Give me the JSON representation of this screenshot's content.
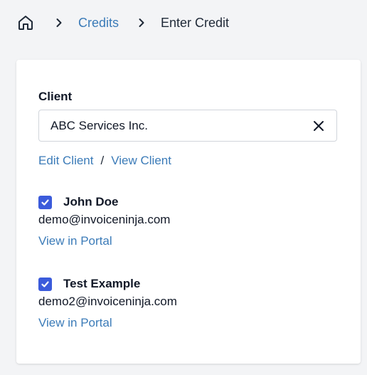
{
  "breadcrumb": {
    "home_icon": "home-icon",
    "items": [
      {
        "label": "Credits"
      },
      {
        "label": "Enter Credit"
      }
    ]
  },
  "client_section": {
    "label": "Client",
    "selected_value": "ABC Services Inc.",
    "clear_icon": "close-icon",
    "edit_link": "Edit Client",
    "separator": "/",
    "view_link": "View Client"
  },
  "contacts": [
    {
      "name": "John Doe",
      "email": "demo@invoiceninja.com",
      "portal_link": "View in Portal",
      "checked": true
    },
    {
      "name": "Test Example",
      "email": "demo2@invoiceninja.com",
      "portal_link": "View in Portal",
      "checked": true
    }
  ],
  "colors": {
    "link": "#3b7bb8",
    "checkbox": "#3b5bdb",
    "background": "#f3f4f6"
  }
}
